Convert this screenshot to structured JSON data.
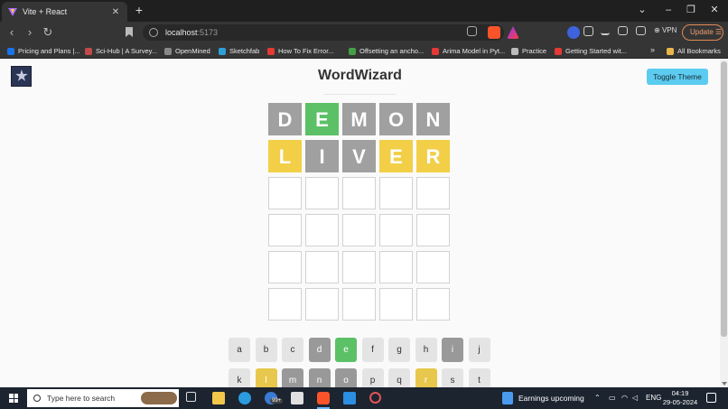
{
  "browser": {
    "tab_title": "Vite + React",
    "tab_close": "✕",
    "new_tab": "+",
    "url_host": "localhost",
    "url_port": ":5173",
    "vpn_label": "VPN",
    "update_label": "Update",
    "bookmarks": [
      {
        "label": "Pricing and Plans |...",
        "color": "#1a73e8"
      },
      {
        "label": "Sci-Hub | A Survey...",
        "color": "#c14a4a"
      },
      {
        "label": "OpenMined",
        "color": "#888888"
      },
      {
        "label": "Sketchfab",
        "color": "#2d9fd9"
      },
      {
        "label": "How To Fix Error...",
        "color": "#e53935"
      },
      {
        "label": "Offsetting an ancho...",
        "color": "#43a047"
      },
      {
        "label": "Arima Model in Pyt...",
        "color": "#e53935"
      },
      {
        "label": "Practice",
        "color": "#bbbbbb"
      },
      {
        "label": "Getting Started wit...",
        "color": "#e53935"
      }
    ],
    "bookmarks_more": "»",
    "all_bookmarks": "All Bookmarks"
  },
  "app": {
    "title": "WordWizard",
    "toggle_theme": "Toggle Theme"
  },
  "board": [
    [
      {
        "l": "D",
        "s": "absent"
      },
      {
        "l": "E",
        "s": "correct"
      },
      {
        "l": "M",
        "s": "absent"
      },
      {
        "l": "O",
        "s": "absent"
      },
      {
        "l": "N",
        "s": "absent"
      }
    ],
    [
      {
        "l": "L",
        "s": "present"
      },
      {
        "l": "I",
        "s": "absent"
      },
      {
        "l": "V",
        "s": "absent"
      },
      {
        "l": "E",
        "s": "present"
      },
      {
        "l": "R",
        "s": "present"
      }
    ],
    [
      {
        "l": "",
        "s": "empty"
      },
      {
        "l": "",
        "s": "empty"
      },
      {
        "l": "",
        "s": "empty"
      },
      {
        "l": "",
        "s": "empty"
      },
      {
        "l": "",
        "s": "empty"
      }
    ],
    [
      {
        "l": "",
        "s": "empty"
      },
      {
        "l": "",
        "s": "empty"
      },
      {
        "l": "",
        "s": "empty"
      },
      {
        "l": "",
        "s": "empty"
      },
      {
        "l": "",
        "s": "empty"
      }
    ],
    [
      {
        "l": "",
        "s": "empty"
      },
      {
        "l": "",
        "s": "empty"
      },
      {
        "l": "",
        "s": "empty"
      },
      {
        "l": "",
        "s": "empty"
      },
      {
        "l": "",
        "s": "empty"
      }
    ],
    [
      {
        "l": "",
        "s": "empty"
      },
      {
        "l": "",
        "s": "empty"
      },
      {
        "l": "",
        "s": "empty"
      },
      {
        "l": "",
        "s": "empty"
      },
      {
        "l": "",
        "s": "empty"
      }
    ]
  ],
  "keyboard": [
    [
      {
        "k": "a",
        "s": ""
      },
      {
        "k": "b",
        "s": ""
      },
      {
        "k": "c",
        "s": ""
      },
      {
        "k": "d",
        "s": "absent"
      },
      {
        "k": "e",
        "s": "correct"
      },
      {
        "k": "f",
        "s": ""
      },
      {
        "k": "g",
        "s": ""
      },
      {
        "k": "h",
        "s": ""
      },
      {
        "k": "i",
        "s": "absent"
      },
      {
        "k": "j",
        "s": ""
      }
    ],
    [
      {
        "k": "k",
        "s": ""
      },
      {
        "k": "l",
        "s": "present"
      },
      {
        "k": "m",
        "s": "absent"
      },
      {
        "k": "n",
        "s": "absent"
      },
      {
        "k": "o",
        "s": "absent"
      },
      {
        "k": "p",
        "s": ""
      },
      {
        "k": "q",
        "s": ""
      },
      {
        "k": "r",
        "s": "present"
      },
      {
        "k": "s",
        "s": ""
      },
      {
        "k": "t",
        "s": ""
      }
    ]
  ],
  "taskbar": {
    "search_placeholder": "Type here to search",
    "news": "Earnings upcoming",
    "badge": "99+",
    "lang": "ENG",
    "time": "04:19",
    "date": "29-05-2024"
  },
  "colors": {
    "correct": "#5cc166",
    "present": "#f2cf47",
    "absent": "#a0a0a0",
    "toggle_button": "#5ccbf0"
  }
}
